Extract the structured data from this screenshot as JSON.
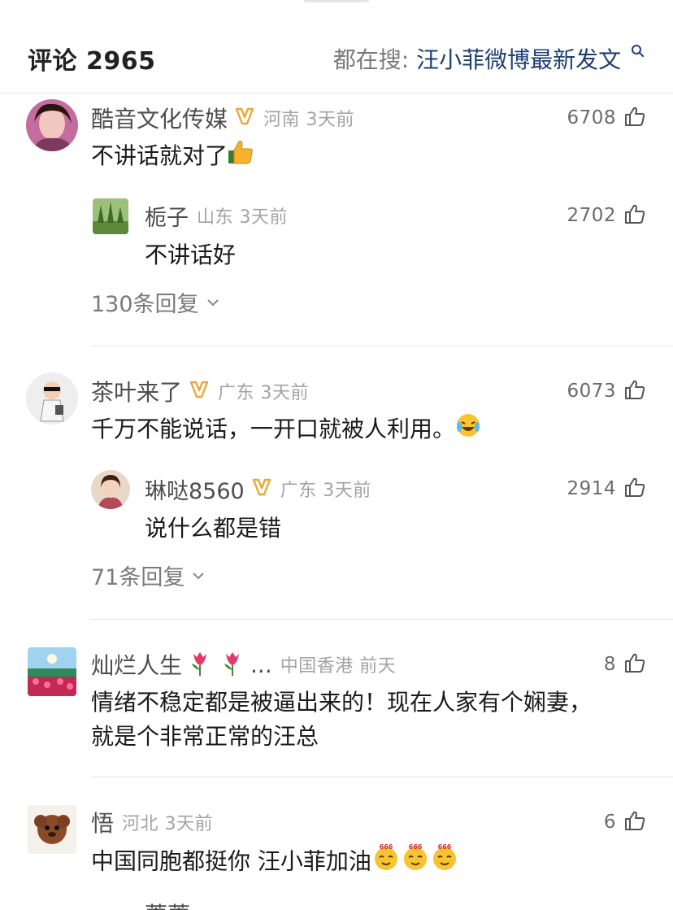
{
  "header": {
    "comment_label": "评论 2965",
    "search_label": "都在搜:",
    "search_term": "汪小菲微博最新发文"
  },
  "comments": [
    {
      "user": "酷音文化传媒",
      "meta": "河南 3天前",
      "likes": "6708",
      "text": "不讲话就对了",
      "emoji": "thumbs-up",
      "reply": {
        "user": "栀子",
        "meta": "山东 3天前",
        "likes": "2702",
        "text": "不讲话好"
      },
      "reply_count": "130条回复"
    },
    {
      "user": "茶叶来了",
      "meta": "广东 3天前",
      "likes": "6073",
      "text": "千万不能说话，一开口就被人利用。",
      "emoji": "laughing-tears",
      "reply": {
        "user": "琳哒8560",
        "meta": "广东 3天前",
        "likes": "2914",
        "text": "说什么都是错"
      },
      "reply_count": "71条回复"
    },
    {
      "user": "灿烂人生",
      "ellipsis": "...",
      "meta": "中国香港 前天",
      "likes": "8",
      "text_line1": "情绪不稳定都是被逼出来的！现在人家有个娴妻，",
      "text_line2": "就是个非常正常的汪总"
    },
    {
      "user": "悟",
      "meta": "河北 3天前",
      "likes": "6",
      "text": "中国同胞都挺你 汪小菲加油",
      "emoji_label": "666"
    }
  ],
  "partial": {
    "user": "蔷蔷"
  },
  "colors": {
    "link": "#1f3f73",
    "meta": "#a3a3a3",
    "vip_gold": "#e8a838"
  }
}
